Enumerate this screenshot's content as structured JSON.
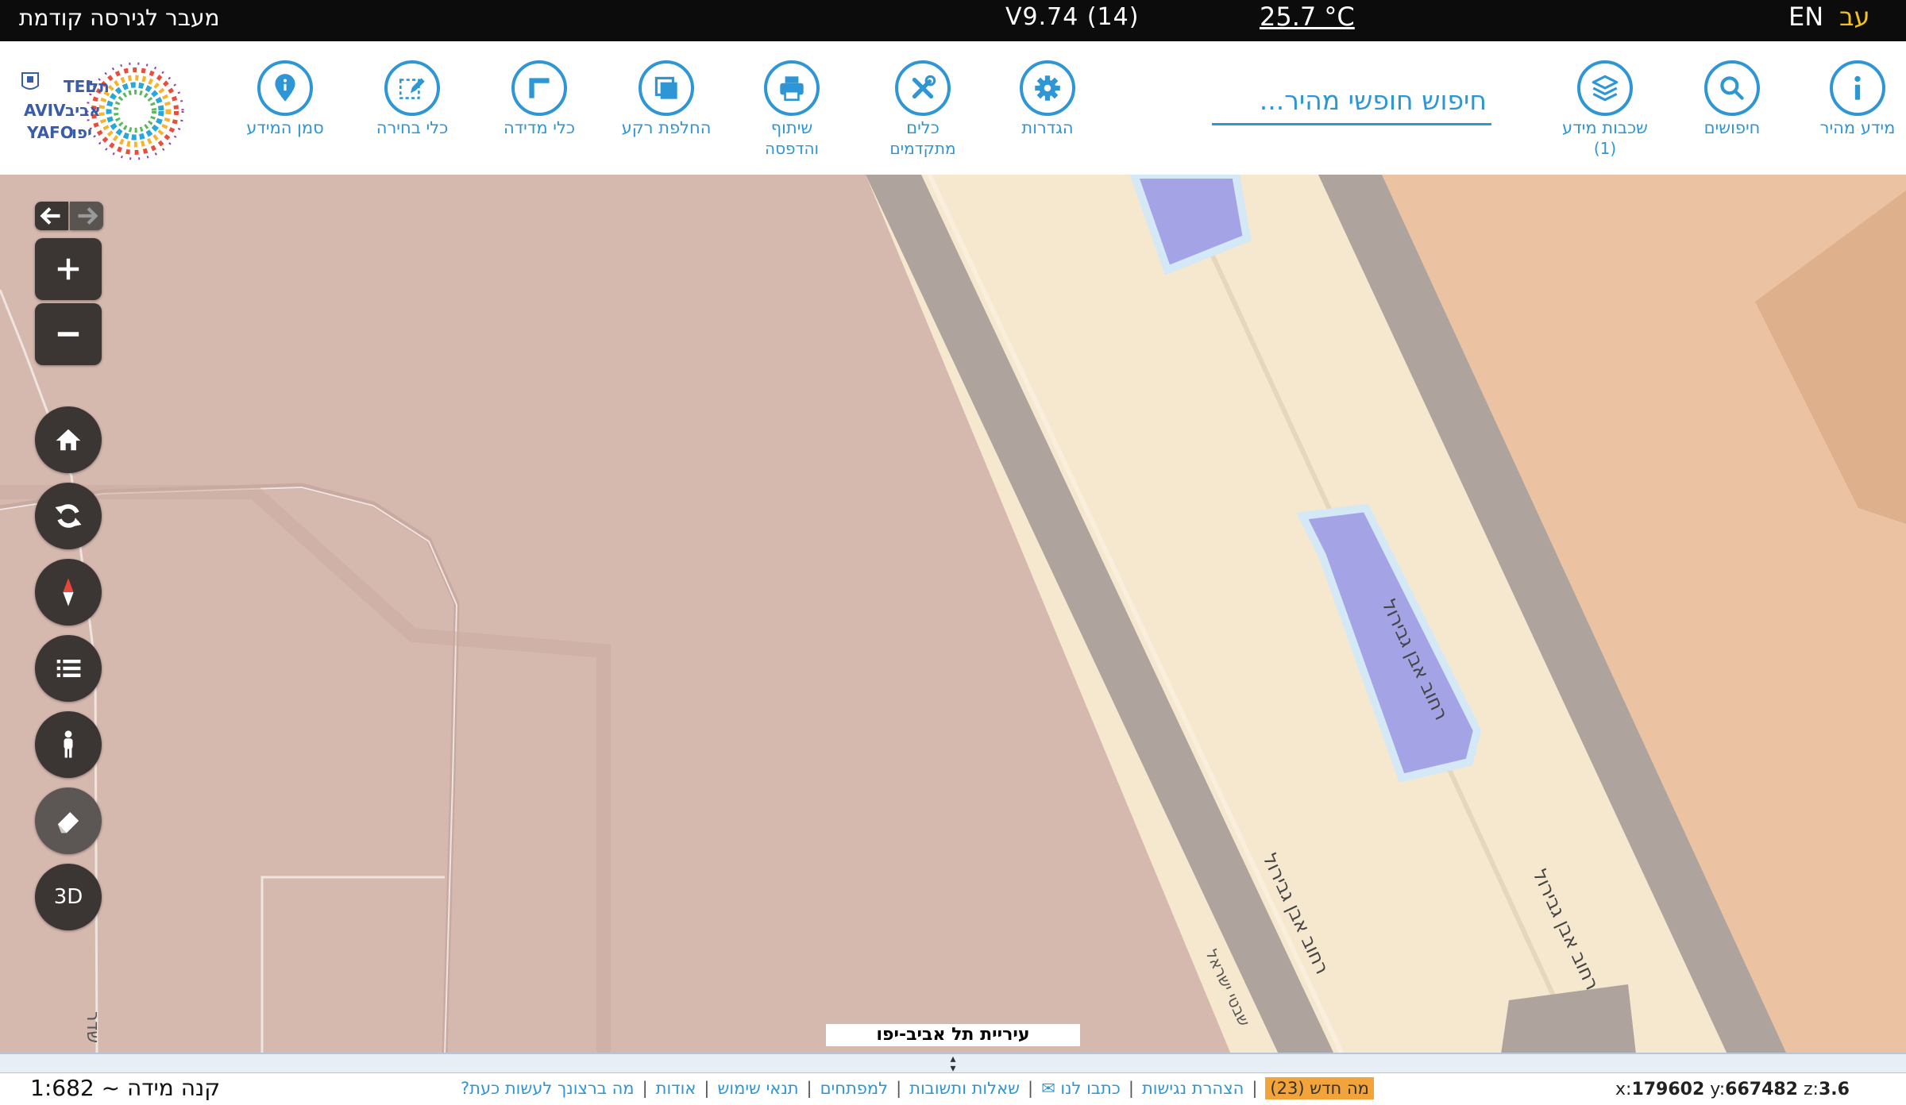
{
  "topbar": {
    "old_version": "מעבר לגירסה קודמת",
    "version": "V9.74 (14)",
    "temperature": "25.7 °C",
    "lang_en": "EN",
    "lang_he": "עב"
  },
  "toolbar": {
    "quick_info": "מידע מהיר",
    "searches": "חיפושים",
    "layers_label": "שכבות מידע",
    "layers_count": "(1)",
    "search_placeholder": "חיפוש חופשי מהיר...",
    "settings": "הגדרות",
    "advanced_tools_1": "כלים",
    "advanced_tools_2": "מתקדמים",
    "share_print_1": "שיתוף",
    "share_print_2": "והדפסה",
    "switch_bg": "החלפת רקע",
    "measure": "כלי מדידה",
    "select_tools": "כלי בחירה",
    "mark_info": "סמן המידע"
  },
  "logo": {
    "text_tel": "TEL",
    "text_aviv": "AVIV",
    "text_yafo": "YAFO",
    "text_he1": "תל",
    "text_he2": "אביב",
    "text_he3": "יפו"
  },
  "map": {
    "street_labels": [
      "רחוב אבן גבירול",
      "רחוב אבן גבירול",
      "רחוב אבן גבירול",
      "רחוב אבן גבירול"
    ],
    "side_street_label": "שבטי ישראל",
    "edge_label": "שדר",
    "city_label": "עיריית תל אביב-יפו",
    "colors": {
      "background": "#d6b9ae",
      "road_fill": "#f5e8cf",
      "road_border": "#aea39d",
      "right_zone": "#ecc3a2",
      "water_blue": "#a4a3e6"
    }
  },
  "controls": {
    "three_d": "3D"
  },
  "footer": {
    "scale": "קנה מידה ~ 1:682",
    "coords_x_label": "x:",
    "coords_x": "179602",
    "coords_y_label": "y:",
    "coords_y": "667482",
    "coords_z_label": "z:",
    "coords_z": "3.6",
    "links": [
      "מה ברצונך לעשות כעת?",
      "אודות",
      "תנאי שימוש",
      "למפתחים",
      "שאלות ותשובות",
      "כתבו לנו ✉",
      "הצהרת נגישות"
    ],
    "whats_new": "מה חדש (23)"
  }
}
